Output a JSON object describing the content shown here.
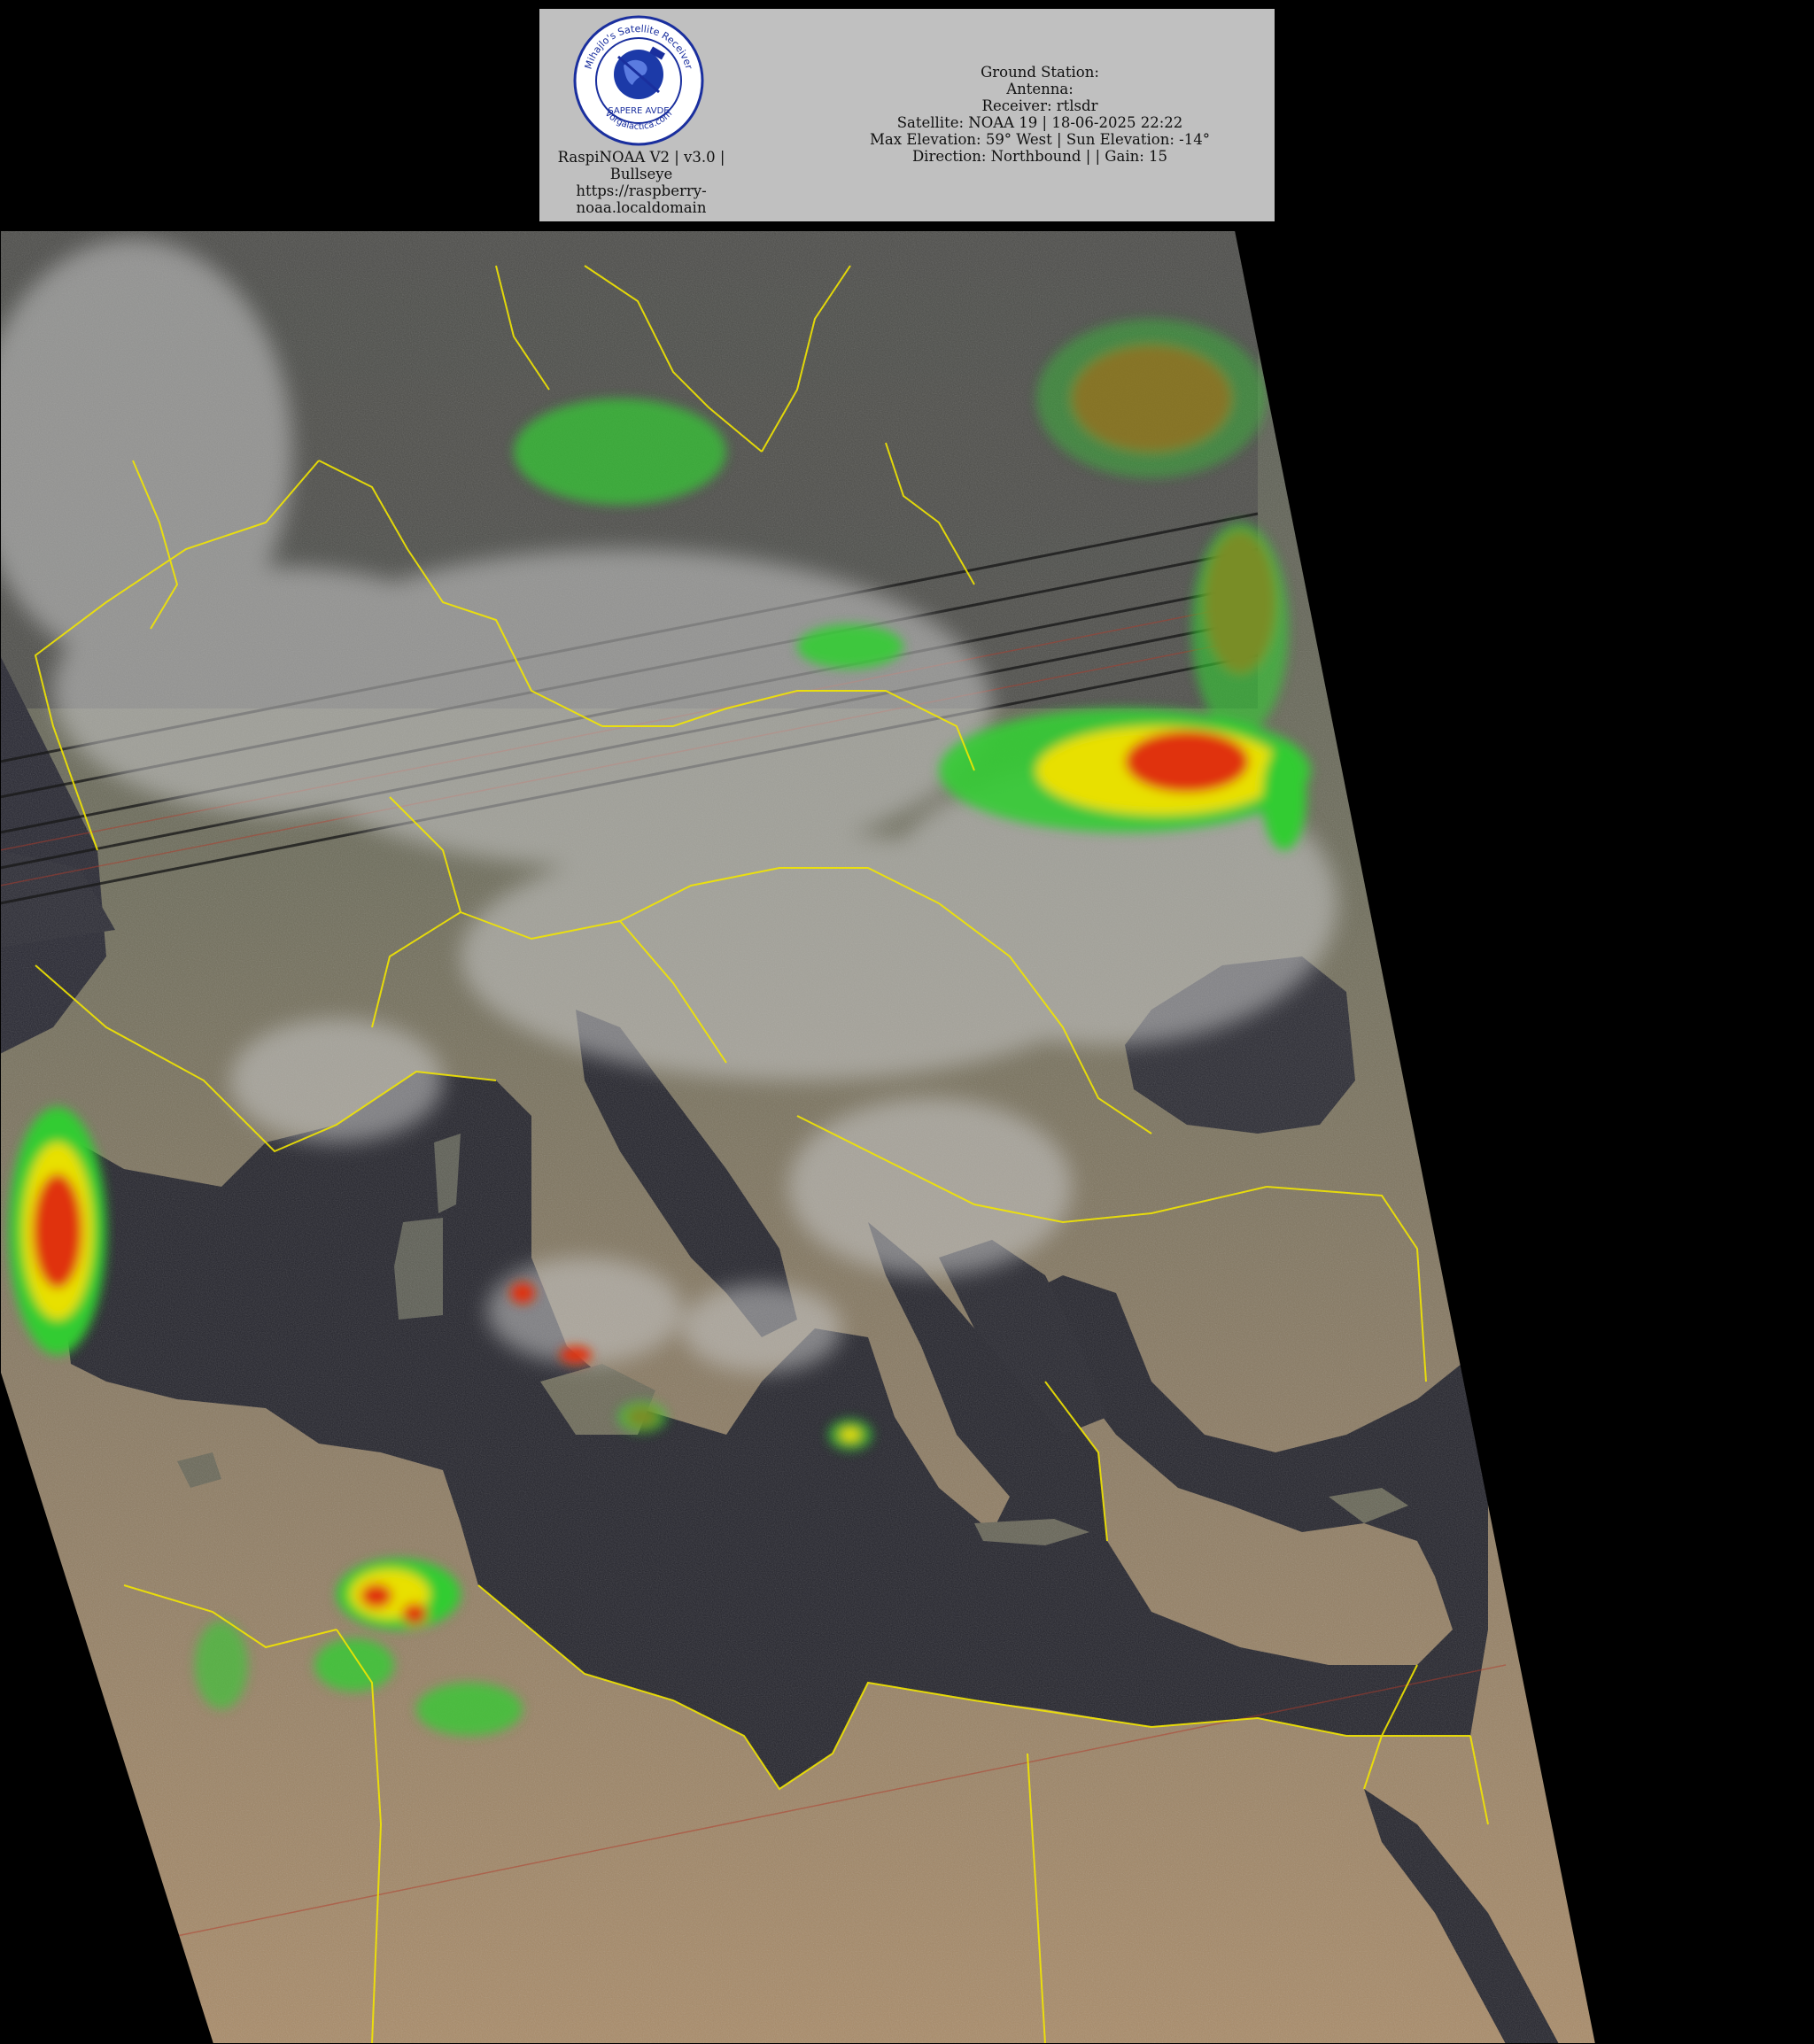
{
  "header": {
    "logo": {
      "ring_text_top": "Mihajlo's Satellite Receiver",
      "ring_text_bottom": "vorgalactica.com",
      "center_text": "SAPERE AVDE",
      "colors": {
        "ring": "#1a2f9e",
        "globe": "#1c3aa8",
        "background": "#ffffff"
      }
    },
    "left_caption": {
      "line1": "RaspiNOAA V2 | v3.0 |",
      "line2": "Bullseye",
      "line3": "https://raspberry-",
      "line4": "noaa.localdomain"
    },
    "info": {
      "ground_station": "Ground Station:",
      "antenna": "Antenna:",
      "receiver": "Receiver: rtlsdr",
      "satellite": "Satellite: NOAA 19 | 18-06-2025 22:22",
      "elevation": "Max Elevation: 59° West | Sun Elevation: -14°",
      "direction": "Direction: Northbound | | Gain: 15"
    },
    "panel_color": "#c0c0c0"
  },
  "image": {
    "description_colors": {
      "background": "#000000",
      "sea": "#23232b",
      "land": "#6b6a55",
      "desert": "#a98b68",
      "cloud": "#c9c9c9",
      "border_lines": "#f2e600",
      "precip_green": "#33cc33",
      "precip_yellow": "#e8e000",
      "precip_red": "#e03010"
    }
  }
}
